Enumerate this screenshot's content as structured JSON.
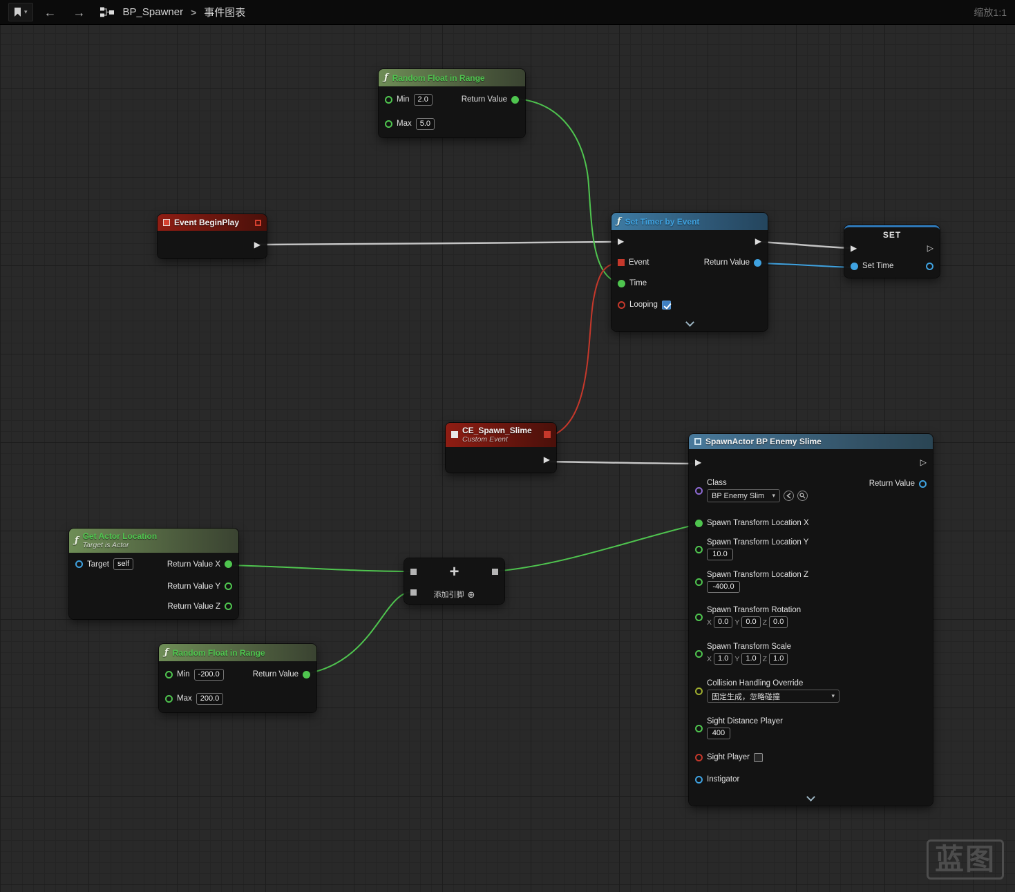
{
  "toolbar": {
    "breadcrumb_root": "BP_Spawner",
    "separator": ">",
    "breadcrumb_page": "事件图表",
    "zoom_label": "缩放1:1"
  },
  "icons": {
    "function_glyph": "ƒ",
    "exec": "▶",
    "exec_hollow": "▷",
    "caret_down": "▾",
    "back_arrow": "←",
    "forward_arrow": "→",
    "plus_operator": "+",
    "circle_plus": "⊕"
  },
  "nodes": {
    "random_float_top": {
      "title": "Random Float in Range",
      "min_label": "Min",
      "min_value": "2.0",
      "max_label": "Max",
      "max_value": "5.0",
      "return_label": "Return Value"
    },
    "event_begin_play": {
      "title": "Event BeginPlay"
    },
    "set_timer": {
      "title": "Set Timer by Event",
      "event_label": "Event",
      "time_label": "Time",
      "looping_label": "Looping",
      "return_label": "Return Value"
    },
    "set_variable": {
      "title": "SET",
      "pin_label": "Set Time"
    },
    "custom_event": {
      "title": "CE_Spawn_Slime",
      "subtitle": "Custom Event"
    },
    "get_actor_location": {
      "title": "Get Actor Location",
      "subtitle": "Target is Actor",
      "target_label": "Target",
      "target_value": "self",
      "return_x_label": "Return Value X",
      "return_y_label": "Return Value Y",
      "return_z_label": "Return Value Z"
    },
    "add": {
      "add_pin_label": "添加引脚"
    },
    "random_float_bottom": {
      "title": "Random Float in Range",
      "min_label": "Min",
      "min_value": "-200.0",
      "max_label": "Max",
      "max_value": "200.0",
      "return_label": "Return Value"
    },
    "spawn_actor": {
      "title": "SpawnActor BP Enemy Slime",
      "class_label": "Class",
      "class_value": "BP Enemy Slim",
      "return_label": "Return Value",
      "location_x_label": "Spawn Transform Location X",
      "location_y_label": "Spawn Transform Location Y",
      "location_y_value": "10.0",
      "location_z_label": "Spawn Transform Location Z",
      "location_z_value": "-400.0",
      "rotation_label": "Spawn Transform Rotation",
      "rotation_x_value": "0.0",
      "rotation_y_value": "0.0",
      "rotation_z_value": "0.0",
      "scale_label": "Spawn Transform Scale",
      "scale_x_value": "1.0",
      "scale_y_value": "1.0",
      "scale_z_value": "1.0",
      "collision_label": "Collision Handling Override",
      "collision_value": "固定生成，忽略碰撞",
      "sight_distance_label": "Sight Distance Player",
      "sight_distance_value": "400",
      "sight_player_label": "Sight Player",
      "instigator_label": "Instigator",
      "axis_x": "X",
      "axis_y": "Y",
      "axis_z": "Z"
    }
  },
  "watermark": "蓝图"
}
